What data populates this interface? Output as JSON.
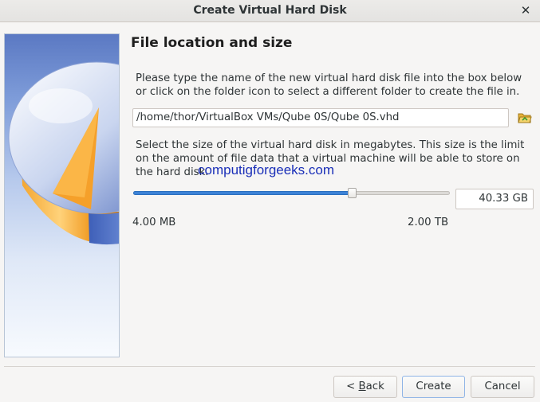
{
  "window": {
    "title": "Create Virtual Hard Disk",
    "close_glyph": "✕"
  },
  "page": {
    "title": "File location and size",
    "location_description": "Please type the name of the new virtual hard disk file into the box below or click on the folder icon to select a different folder to create the file in.",
    "file_path": "/home/thor/VirtualBox VMs/Qube 0S/Qube 0S.vhd",
    "size_description": "Select the size of the virtual hard disk in megabytes. This size is the limit on the amount of file data that a virtual machine will be able to store on the hard disk.",
    "watermark": "computigforgeeks.com"
  },
  "size": {
    "value_label": "40.33 GB",
    "slider_fraction": 0.69,
    "min_label": "4.00 MB",
    "max_label": "2.00 TB"
  },
  "buttons": {
    "back_prefix": "< ",
    "back_mnemonic": "B",
    "back_rest": "ack",
    "create": "Create",
    "cancel": "Cancel"
  },
  "icons": {
    "close": "close-icon",
    "folder": "folder-icon",
    "side_art": "hard-disk-wizard-image"
  },
  "colors": {
    "accent": "#3d83d6",
    "watermark": "#1a2fb8"
  }
}
